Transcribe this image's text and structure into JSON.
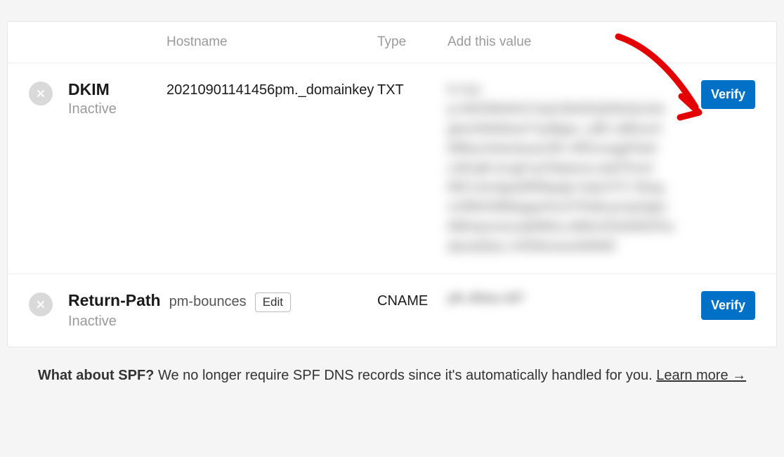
{
  "headers": {
    "hostname": "Hostname",
    "type": "Type",
    "value": "Add this value"
  },
  "rows": [
    {
      "name": "DKIM",
      "status": "Inactive",
      "hostname": "20210901141456pm._domainkey",
      "type": "TXT",
      "verify_label": "Verify"
    },
    {
      "name": "Return-Path",
      "status": "Inactive",
      "hostname": "pm-bounces",
      "edit_label": "Edit",
      "type": "CNAME",
      "verify_label": "Verify"
    }
  ],
  "footer": {
    "bold": "What about SPF?",
    "text": " We no longer require SPF DNS records since it's automatically handled for you. ",
    "link": "Learn more →"
  }
}
